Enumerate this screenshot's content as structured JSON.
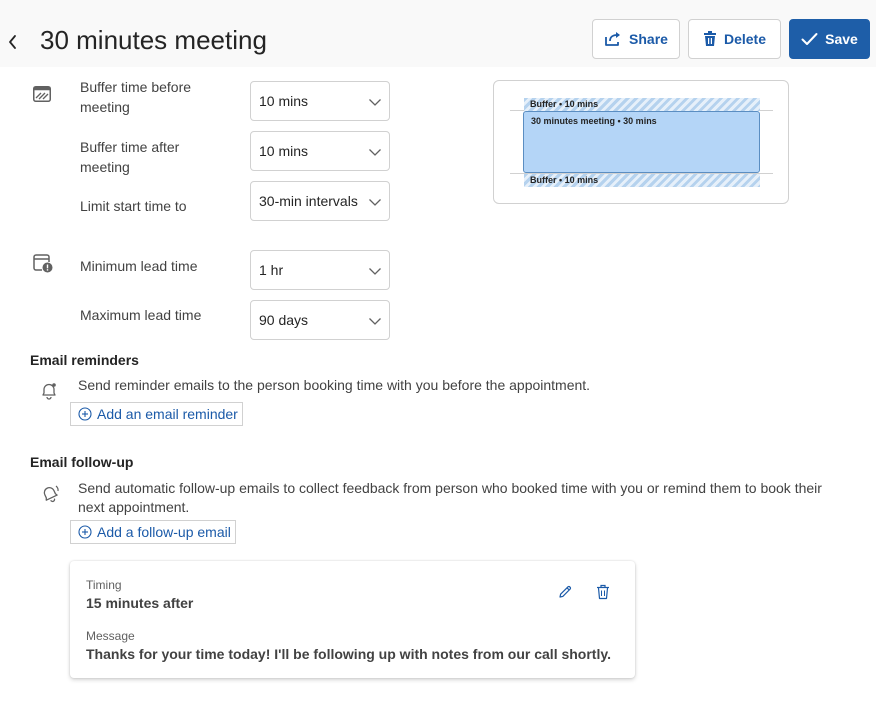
{
  "header": {
    "title": "30 minutes meeting",
    "share_label": "Share",
    "delete_label": "Delete",
    "save_label": "Save"
  },
  "buffer_settings": {
    "buffer_before": {
      "label": "Buffer time before meeting",
      "value": "10 mins"
    },
    "buffer_after": {
      "label": "Buffer time after meeting",
      "value": "10 mins"
    },
    "limit_start": {
      "label": "Limit start time to",
      "value": "30-min intervals"
    }
  },
  "lead_time": {
    "minimum": {
      "label": "Minimum lead time",
      "value": "1 hr"
    },
    "maximum": {
      "label": "Maximum lead time",
      "value": "90 days"
    }
  },
  "preview": {
    "buffer_top": "Buffer • 10 mins",
    "meeting": "30 minutes meeting • 30 mins",
    "buffer_bottom": "Buffer • 10 mins"
  },
  "email_reminders": {
    "title": "Email reminders",
    "description": "Send reminder emails to the person booking time with you before the appointment.",
    "add_label": "Add an email reminder"
  },
  "email_followup": {
    "title": "Email follow-up",
    "description_line1": "Send automatic follow-up emails to collect feedback from person who booked time with you or remind them to book their",
    "description_line2": "next appointment.",
    "add_label": "Add a follow-up email",
    "card": {
      "timing_label": "Timing",
      "timing_value": "15 minutes after",
      "message_label": "Message",
      "message_value": "Thanks for your time today! I'll be following up with notes from our call shortly."
    }
  },
  "colors": {
    "accent": "#1e5ea8",
    "link": "#1b5aa8",
    "meeting_block": "#b4d5f7",
    "buffer_hatch": "#b5d2ee"
  },
  "icons": {
    "back": "chevron-left-icon",
    "share": "share-icon",
    "delete": "trash-icon",
    "save": "checkmark-icon",
    "buffer": "calendar-buffer-icon",
    "lead": "calendar-alert-icon",
    "reminder": "bell-icon",
    "followup": "bell-ring-icon",
    "add": "add-circle-icon",
    "edit": "pencil-icon",
    "remove": "trash-icon",
    "dropdown": "chevron-down-icon"
  }
}
